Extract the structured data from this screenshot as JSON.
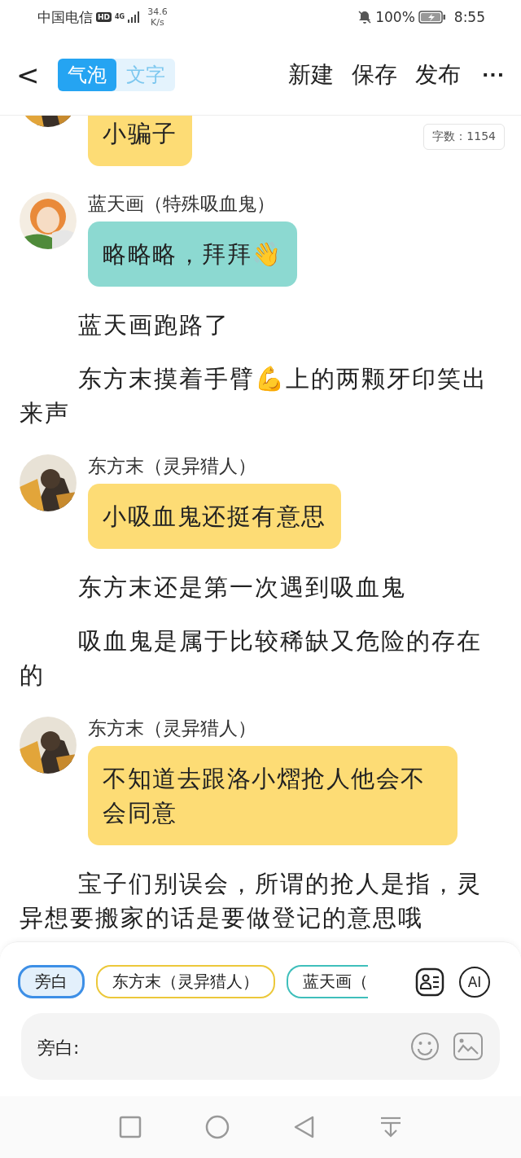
{
  "status_bar": {
    "carrier": "中国电信",
    "network_badge": "HD",
    "network_type": "4G",
    "speed_value": "34.6",
    "speed_unit": "K/s",
    "battery": "100%",
    "time": "8:55"
  },
  "header": {
    "back": "<",
    "mode_tabs": [
      {
        "label": "气泡",
        "selected": true
      },
      {
        "label": "文字",
        "selected": false
      }
    ],
    "actions": [
      "新建",
      "保存",
      "发布"
    ],
    "more": "···"
  },
  "word_count": "字数：1154",
  "feed": [
    {
      "kind": "message",
      "text": "小骗子",
      "color": "#fddc75"
    },
    {
      "kind": "message",
      "speaker": "蓝天画（特殊吸血鬼）",
      "text": "略略略，拜拜👋",
      "color": "#8cd9d1"
    },
    {
      "kind": "narration",
      "text": "蓝天画跑路了"
    },
    {
      "kind": "narration",
      "text": "东方末摸着手臂💪上的两颗牙印笑出来声"
    },
    {
      "kind": "message",
      "speaker": "东方末（灵异猎人）",
      "text": "小吸血鬼还挺有意思",
      "color": "#fddc75"
    },
    {
      "kind": "narration",
      "text": "东方末还是第一次遇到吸血鬼"
    },
    {
      "kind": "narration",
      "text": "吸血鬼是属于比较稀缺又危险的存在的"
    },
    {
      "kind": "message",
      "speaker": "东方末（灵异猎人）",
      "text": "不知道去跟洛小熠抢人他会不会同意",
      "color": "#fddc75"
    },
    {
      "kind": "narration",
      "text": "宝子们别误会，所谓的抢人是指，灵异想要搬家的话是要做登记的意思哦"
    }
  ],
  "composer": {
    "roles": [
      {
        "label": "旁白",
        "selected": true,
        "color": "#3d8fe6"
      },
      {
        "label": "东方末（灵异猎人）",
        "selected": false,
        "color": "#ecc83a"
      },
      {
        "label": "蓝天画（",
        "selected": false,
        "color": "#3fbfbb"
      }
    ],
    "ai_label": "AI",
    "input_label": "旁白:"
  }
}
